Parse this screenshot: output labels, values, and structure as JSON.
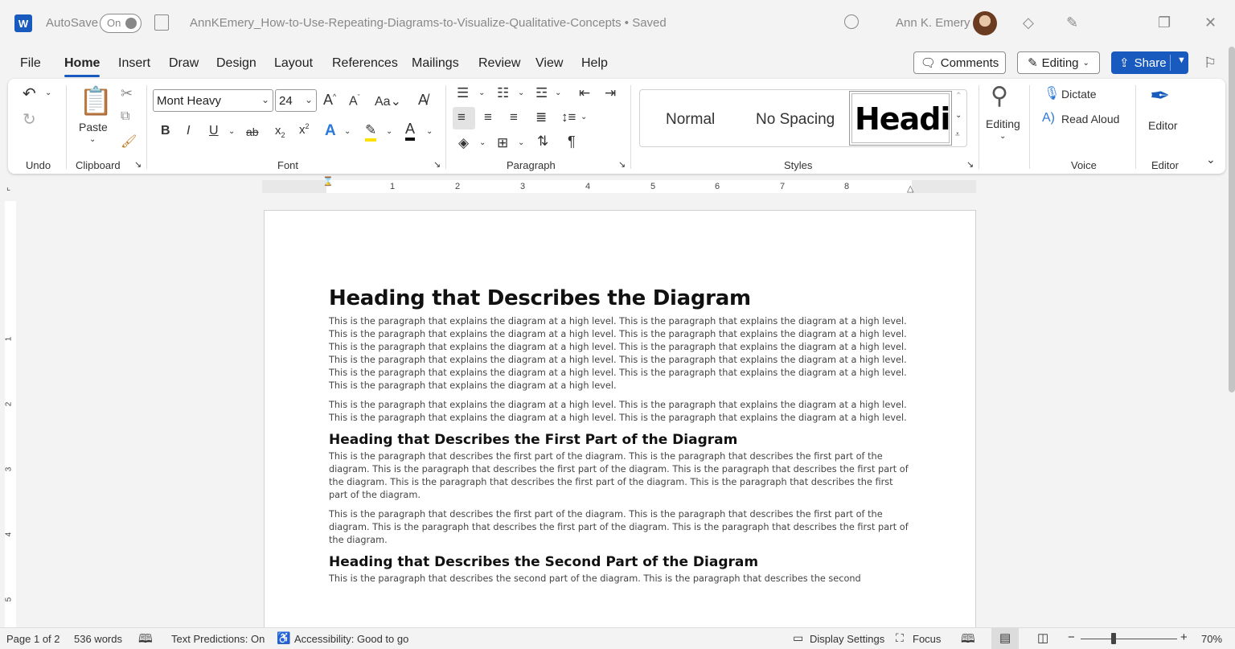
{
  "titlebar": {
    "app_logo": "W",
    "autosave_label": "AutoSave",
    "autosave_state": "On",
    "doc_title": "AnnKEmery_How-to-Use-Repeating-Diagrams-to-Visualize-Qualitative-Concepts • Saved",
    "user_name": "Ann K. Emery"
  },
  "menu": {
    "tabs": [
      "File",
      "Home",
      "Insert",
      "Draw",
      "Design",
      "Layout",
      "References",
      "Mailings",
      "Review",
      "View",
      "Help"
    ],
    "comments_label": "Comments",
    "editing_label": "Editing",
    "share_label": "Share"
  },
  "ribbon": {
    "groups": {
      "undo": "Undo",
      "clipboard": "Clipboard",
      "font": "Font",
      "paragraph": "Paragraph",
      "styles": "Styles",
      "voice": "Voice",
      "editor": "Editor"
    },
    "paste_label": "Paste",
    "font_name": "Mont Heavy",
    "font_size": "24",
    "styles": {
      "normal": "Normal",
      "no_spacing": "No Spacing",
      "heading": "Headi"
    },
    "editing_label": "Editing",
    "dictate_label": "Dictate",
    "read_aloud_label": "Read Aloud",
    "editor_label": "Editor",
    "accent_color": "#185abd"
  },
  "ruler": {
    "numbers": [
      "1",
      "2",
      "3",
      "4",
      "5",
      "6",
      "7",
      "8"
    ],
    "vertical_numbers": [
      "1",
      "2",
      "3",
      "4",
      "5"
    ]
  },
  "document": {
    "heading1": "Heading that Describes the Diagram",
    "p1": "This is the paragraph that explains the diagram at a high level. This is the paragraph that explains the diagram at a high level. This is the paragraph that explains the diagram at a high level. This is the paragraph that explains the diagram at a high level. This is the paragraph that explains the diagram at a high level. This is the paragraph that explains the diagram at a high level. This is the paragraph that explains the diagram at a high level. This is the paragraph that explains the diagram at a high level. This is the paragraph that explains the diagram at a high level. This is the paragraph that explains the diagram at a high level. This is the paragraph that explains the diagram at a high level.",
    "p2": "This is the paragraph that explains the diagram at a high level. This is the paragraph that explains the diagram at a high level. This is the paragraph that explains the diagram at a high level. This is the paragraph that explains the diagram at a high level.",
    "heading2": "Heading that Describes the First Part of the Diagram",
    "p3": "This is the paragraph that describes the first part of the diagram. This is the paragraph that describes the first part of the diagram. This is the paragraph that describes the first part of the diagram. This is the paragraph that describes the first part of the diagram. This is the paragraph that describes the first part of the diagram. This is the paragraph that describes the first part of the diagram.",
    "p4": "This is the paragraph that describes the first part of the diagram. This is the paragraph that describes the first part of the diagram. This is the paragraph that describes the first part of the diagram. This is the paragraph that describes the first part of the diagram.",
    "heading3": "Heading that Describes the Second Part of the Diagram",
    "p5": "This is the paragraph that describes the second part of the diagram. This is the paragraph that describes the second"
  },
  "statusbar": {
    "page": "Page 1 of 2",
    "words": "536 words",
    "text_predictions": "Text Predictions: On",
    "accessibility": "Accessibility: Good to go",
    "display_settings": "Display Settings",
    "focus": "Focus",
    "zoom_minus": "−",
    "zoom_plus": "+",
    "zoom": "70%"
  }
}
